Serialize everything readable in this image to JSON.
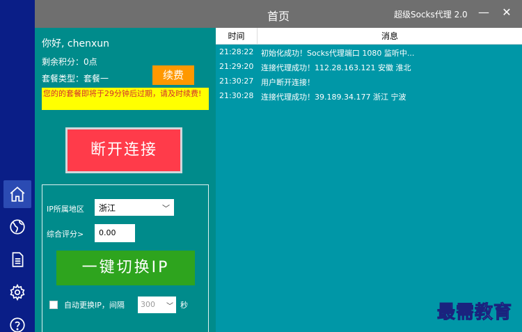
{
  "titlebar": {
    "title": "首页",
    "app_name": "超级Socks代理 2.0",
    "minimize": "—",
    "close": "✕"
  },
  "user": {
    "greeting": "你好, chenxun",
    "points": "剩余积分：0点",
    "plan": "套餐类型：套餐一",
    "renew_label": "续费",
    "notice": "您的的套餐即将于29分钟后过期，请及时续费!"
  },
  "disconnect_label": "断开连接",
  "settings": {
    "region_label": "IP所属地区",
    "region_value": "浙江",
    "score_label": "综合评分>",
    "score_value": "0.00",
    "switch_label": "一键切换IP",
    "auto_label": "自动更换IP，间隔",
    "interval_value": "300",
    "unit": "秒"
  },
  "log": {
    "col_time": "时间",
    "col_msg": "消息",
    "rows": [
      {
        "time": "21:28:22",
        "msg": "初始化成功！Socks代理端口 1080 监听中..."
      },
      {
        "time": "21:29:20",
        "msg": "连接代理成功！112.28.163.121 安徽 淮北"
      },
      {
        "time": "21:30:27",
        "msg": "用户断开连接！"
      },
      {
        "time": "21:30:28",
        "msg": "连接代理成功！39.189.34.177 浙江 宁波"
      }
    ]
  },
  "watermark": "最需教育",
  "rail_icons": [
    "home-icon",
    "globe-icon",
    "document-icon",
    "gear-icon",
    "help-icon"
  ],
  "colors": {
    "rail": "#0a1e87",
    "panel": "#008b8b",
    "log_bg": "#0097a7",
    "renew": "#ff9800",
    "disconnect": "#ff3b4a",
    "switch": "#2ea41e",
    "notice_bg": "#ffff00"
  }
}
